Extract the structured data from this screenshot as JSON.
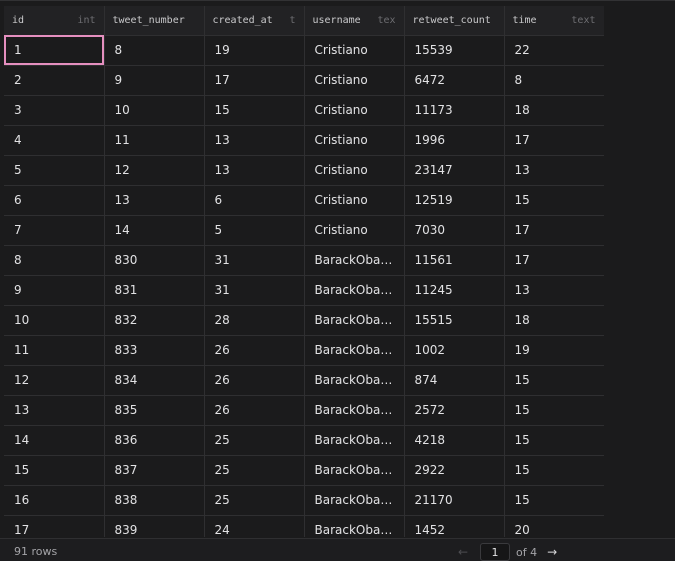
{
  "table": {
    "columns": [
      {
        "name": "id",
        "type": "int"
      },
      {
        "name": "tweet_number",
        "type": ""
      },
      {
        "name": "created_at",
        "type": "t"
      },
      {
        "name": "username",
        "type": "tex"
      },
      {
        "name": "retweet_count",
        "type": ""
      },
      {
        "name": "time",
        "type": "text"
      }
    ],
    "rows": [
      [
        "1",
        "8",
        "19",
        "Cristiano",
        "15539",
        "22"
      ],
      [
        "2",
        "9",
        "17",
        "Cristiano",
        "6472",
        "8"
      ],
      [
        "3",
        "10",
        "15",
        "Cristiano",
        "11173",
        "18"
      ],
      [
        "4",
        "11",
        "13",
        "Cristiano",
        "1996",
        "17"
      ],
      [
        "5",
        "12",
        "13",
        "Cristiano",
        "23147",
        "13"
      ],
      [
        "6",
        "13",
        "6",
        "Cristiano",
        "12519",
        "15"
      ],
      [
        "7",
        "14",
        "5",
        "Cristiano",
        "7030",
        "17"
      ],
      [
        "8",
        "830",
        "31",
        "BarackOba…",
        "11561",
        "17"
      ],
      [
        "9",
        "831",
        "31",
        "BarackOba…",
        "11245",
        "13"
      ],
      [
        "10",
        "832",
        "28",
        "BarackOba…",
        "15515",
        "18"
      ],
      [
        "11",
        "833",
        "26",
        "BarackOba…",
        "1002",
        "19"
      ],
      [
        "12",
        "834",
        "26",
        "BarackOba…",
        "874",
        "15"
      ],
      [
        "13",
        "835",
        "26",
        "BarackOba…",
        "2572",
        "15"
      ],
      [
        "14",
        "836",
        "25",
        "BarackOba…",
        "4218",
        "15"
      ],
      [
        "15",
        "837",
        "25",
        "BarackOba…",
        "2922",
        "15"
      ],
      [
        "16",
        "838",
        "25",
        "BarackOba…",
        "21170",
        "15"
      ],
      [
        "17",
        "839",
        "24",
        "BarackOba…",
        "1452",
        "20"
      ]
    ]
  },
  "footer": {
    "row_count": "91 rows",
    "page_value": "1",
    "of_pages": "of 4",
    "prev_icon": "←",
    "next_icon": "→"
  }
}
